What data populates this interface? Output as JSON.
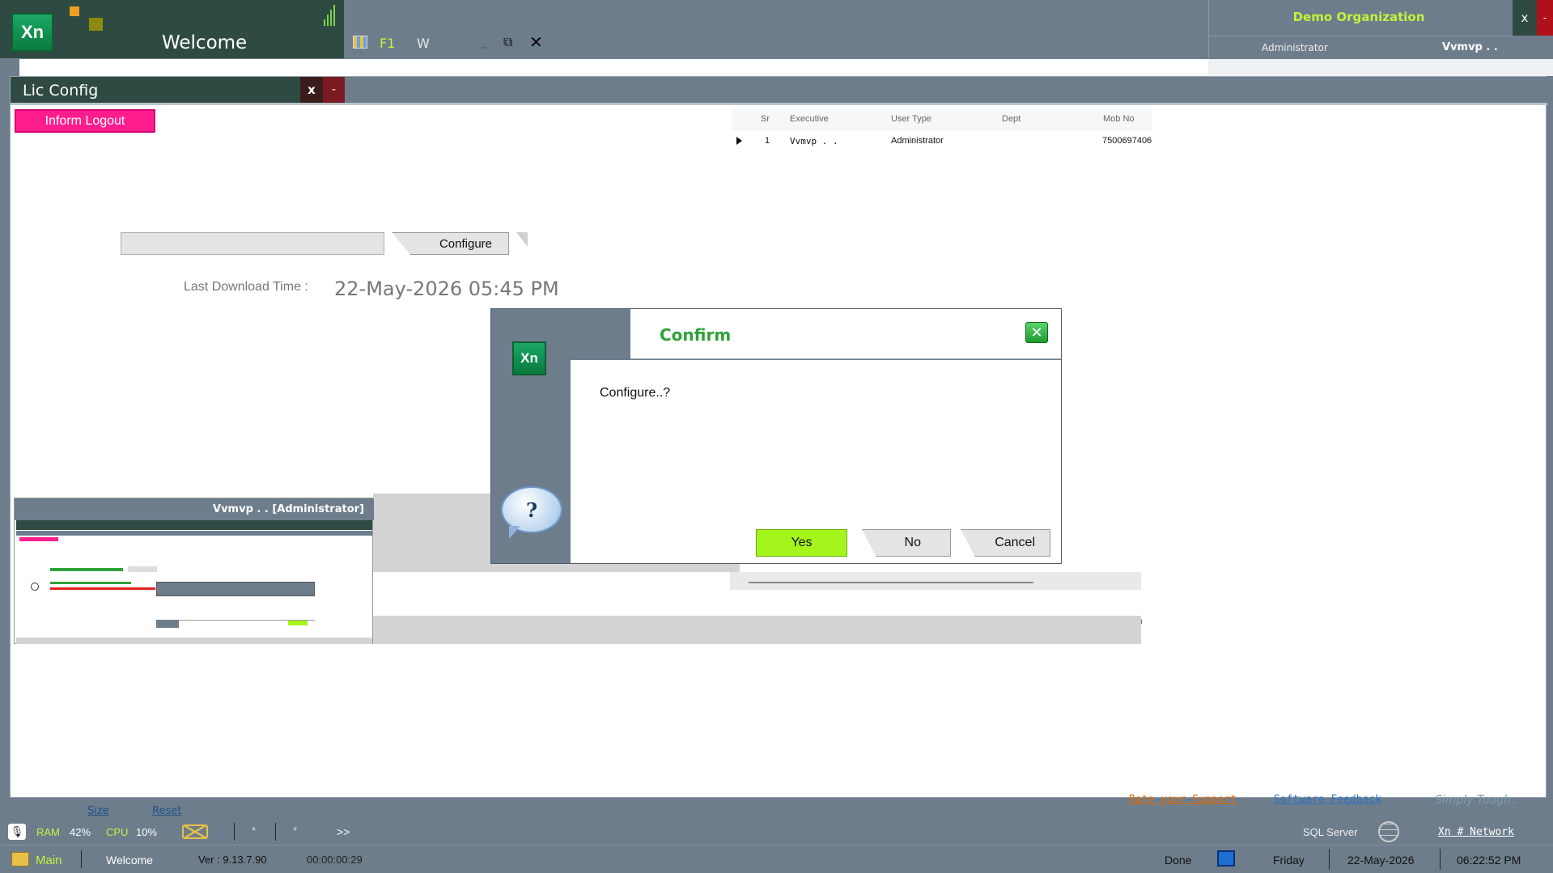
{
  "app": {
    "logo_text": "Xn",
    "window_title": "Welcome",
    "f1_label": "F1",
    "w_label": "W"
  },
  "org": {
    "name": "Demo Organization",
    "role": "Administrator",
    "user": "Vvmvp . .",
    "close_label": "x",
    "min_label": "-"
  },
  "lic": {
    "title": "Lic Config",
    "close_label": "x",
    "min_label": "-",
    "inform_logout": "Inform Logout",
    "configure_label": "Configure",
    "download_label": "Last Download Time :",
    "download_time": "22-May-2026 05:45 PM"
  },
  "grid": {
    "columns": [
      "Sr",
      "Executive",
      "User Type",
      "Dept",
      "Mob No"
    ],
    "rows": [
      {
        "sr": "1",
        "executive": "Vvmvp . .",
        "user_type": "Administrator",
        "dept": "",
        "mob": "7500697406"
      }
    ]
  },
  "thumbnail": {
    "caption": "Vvmvp . . [Administrator]"
  },
  "bottom_links": {
    "size": "Size",
    "reset": "Reset",
    "rate_support": "Rate your Support",
    "software_feedback": "Software Feedback",
    "slogan": "Simply Tough.."
  },
  "status": {
    "ram_label": "RAM",
    "ram_value": "42%",
    "cpu_label": "CPU",
    "cpu_value": "10%",
    "star1": "*",
    "star2": "*",
    "more": ">>",
    "sql_server": "SQL Server",
    "network": "Xn # Network",
    "main_label": "Main",
    "welcome": "Welcome",
    "version": "Ver : 9.13.7.90",
    "elapsed": "00:00:00:29",
    "done": "Done",
    "day": "Friday",
    "date": "22-May-2026",
    "time": "06:22:52 PM"
  },
  "confirm": {
    "title": "Confirm",
    "close_label": "✕",
    "logo_text": "Xn",
    "message": "Configure..?",
    "question_mark": "?",
    "yes": "Yes",
    "no": "No",
    "cancel": "Cancel"
  },
  "colors": {
    "titlebar_dark": "#2f4a42",
    "chrome_grey": "#6e7d8c",
    "accent_lime": "#c6f23a",
    "logout_pink": "#ff1d8e",
    "yes_green": "#a4f51c",
    "confirm_green": "#2fa23a"
  },
  "icons": [
    "app-logo-icon",
    "signal-icon",
    "grid-icon",
    "restore-icon",
    "close-icon",
    "question-bubble-icon",
    "mail-icon",
    "globe-icon",
    "monitor-icon",
    "mic-icon",
    "home-icon"
  ]
}
